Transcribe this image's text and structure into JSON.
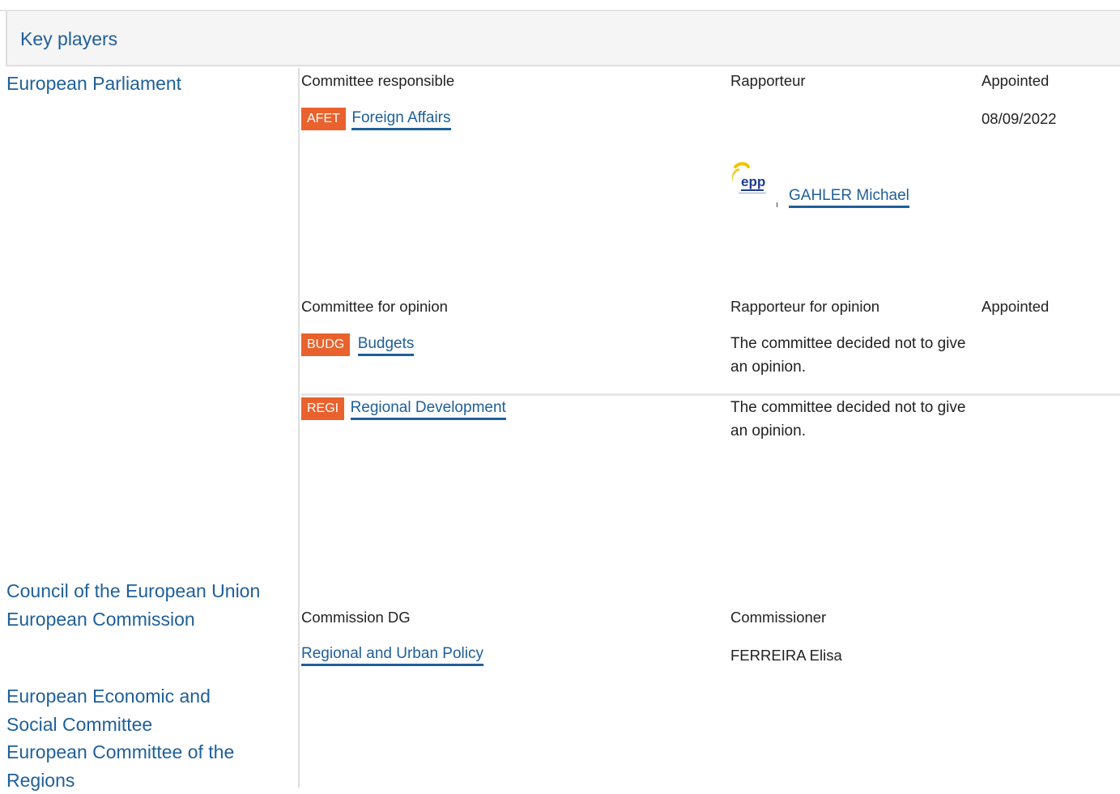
{
  "header": {
    "title": "Key players"
  },
  "institutions": {
    "ep": "European Parliament",
    "council": "Council of the European Union",
    "commission": "European Commission",
    "eesc": [
      "European Economic and",
      "Social Committee"
    ],
    "cor": [
      "European Committee of the",
      "Regions"
    ]
  },
  "ep": {
    "responsible": {
      "col_committee": "Committee responsible",
      "col_rapporteur": "Rapporteur",
      "col_appointed": "Appointed",
      "committee_code": "AFET",
      "committee_name": "Foreign Affairs",
      "appointed_date": "08/09/2022",
      "rapporteur_name": "GAHLER Michael",
      "party_logo_text": "epp"
    },
    "opinion": {
      "col_committee": "Committee for opinion",
      "col_rapporteur": "Rapporteur for opinion",
      "col_appointed": "Appointed",
      "rows": [
        {
          "code": "BUDG",
          "name": "Budgets",
          "note": "The committee decided not to give an opinion."
        },
        {
          "code": "REGI",
          "name": "Regional Development",
          "note": "The committee decided not to give an opinion."
        }
      ]
    }
  },
  "commission": {
    "col_dg": "Commission DG",
    "col_commissioner": "Commissioner",
    "dg_name": "Regional and Urban Policy",
    "commissioner": "FERREIRA Elisa"
  },
  "colors": {
    "link": "#1f5f99",
    "badge": "#e9622e",
    "header_bg": "#f5f5f5",
    "border": "#dedede"
  },
  "icons": {
    "party_logo": "epp-logo-icon"
  }
}
